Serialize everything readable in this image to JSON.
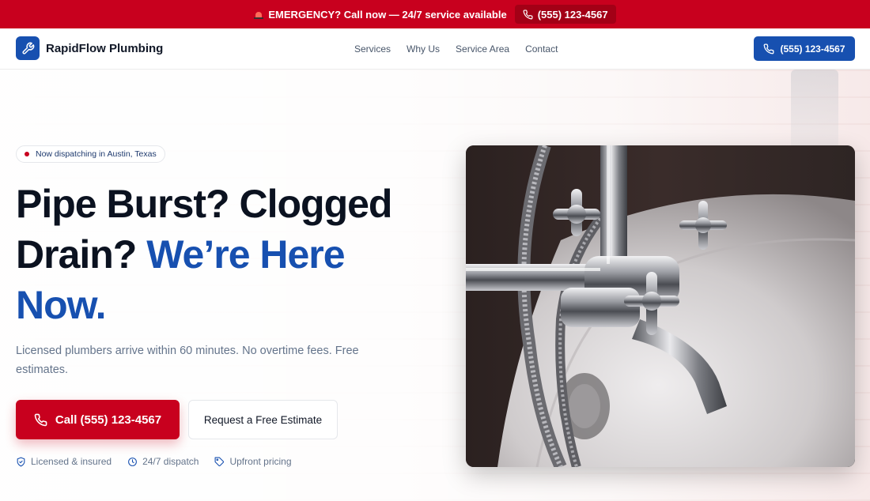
{
  "emergency_bar": {
    "message": "EMERGENCY? Call now — 24/7 service available",
    "phone": "(555) 123-4567",
    "bg_color": "#c8001e"
  },
  "header": {
    "brand": "RapidFlow Plumbing",
    "logo_icon": "wrench-icon",
    "nav": [
      "Services",
      "Why Us",
      "Service Area",
      "Contact"
    ],
    "phone": "(555) 123-4567",
    "accent_color": "#1750b0"
  },
  "hero": {
    "badge": "Now dispatching in Austin, Texas",
    "headline_main": "Pipe Burst? Clogged Drain?",
    "headline_accent": "We’re Here Now.",
    "subtext": "Licensed plumbers arrive within 60 minutes. No overtime fees. Free estimates.",
    "cta_call": "Call (555) 123-4567",
    "cta_estimate": "Request a Free Estimate",
    "trust": [
      {
        "icon": "shield-check-icon",
        "label": "Licensed & insured"
      },
      {
        "icon": "clock-icon",
        "label": "24/7 dispatch"
      },
      {
        "icon": "tag-icon",
        "label": "Upfront pricing"
      }
    ]
  }
}
